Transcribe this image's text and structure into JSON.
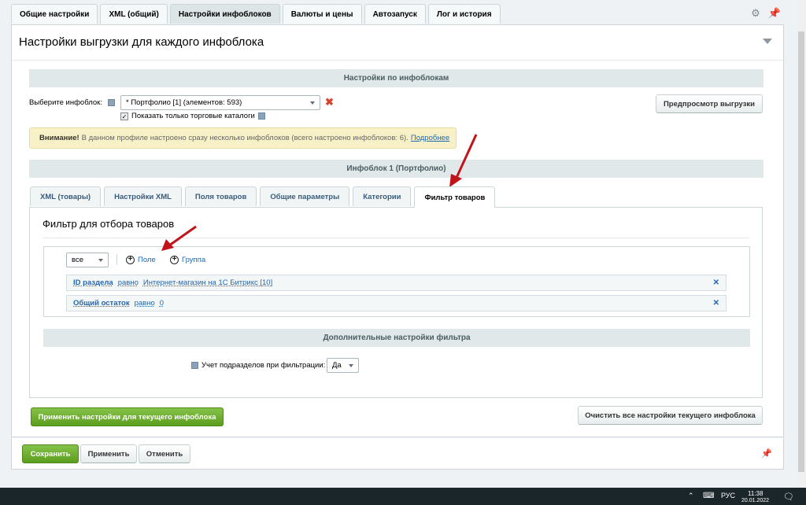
{
  "top_tabs": [
    "Общие настройки",
    "XML (общий)",
    "Настройки инфоблоков",
    "Валюты и цены",
    "Автозапуск",
    "Лог и история"
  ],
  "active_top_tab": "Настройки инфоблоков",
  "page_title": "Настройки выгрузки для каждого инфоблока",
  "section_infoblocks": "Настройки по инфоблокам",
  "select_iblock_label": "Выберите инфоблок:",
  "iblock_selected": "* Портфолио [1] (элементов: 593)",
  "only_trade_catalogs": "Показать только торговые каталоги",
  "preview_button": "Предпросмотр выгрузки",
  "warning": {
    "strong": "Внимание!",
    "text": "В данном профиле настроено сразу несколько инфоблоков (всего настроено инфоблоков: 6).",
    "link": "Подробнее"
  },
  "iblock_header": "Инфоблок 1 (Портфолио)",
  "sub_tabs": [
    "XML (товары)",
    "Настройки XML",
    "Поля товаров",
    "Общие параметры",
    "Категории",
    "Фильтр товаров"
  ],
  "active_sub_tab": "Фильтр товаров",
  "filter": {
    "title": "Фильтр для отбора товаров",
    "logic_value": "все",
    "add_field": "Поле",
    "add_group": "Группа",
    "conditions": [
      {
        "field": "ID раздела",
        "op": "равно",
        "value": "Интернет-магазин на 1С Битрикс [10]"
      },
      {
        "field": "Общий остаток",
        "op": "равно",
        "value": "0"
      }
    ]
  },
  "extra_filter_header": "Дополнительные настройки фильтра",
  "subsections_label": "Учет подразделов при фильтрации:",
  "subsections_value": "Да",
  "apply_button": "Применить настройки для текущего инфоблока",
  "clear_button": "Очистить все настройки текущего инфоблока",
  "footer_buttons": {
    "save": "Сохранить",
    "apply": "Применить",
    "cancel": "Отменить"
  },
  "taskbar": {
    "lang": "РУС",
    "time": "11:38",
    "date": "20.01.2022"
  },
  "colors": {
    "accent_green": "#5b9d1d",
    "link_blue": "#2067b0",
    "arrow_red": "#c0141a"
  }
}
